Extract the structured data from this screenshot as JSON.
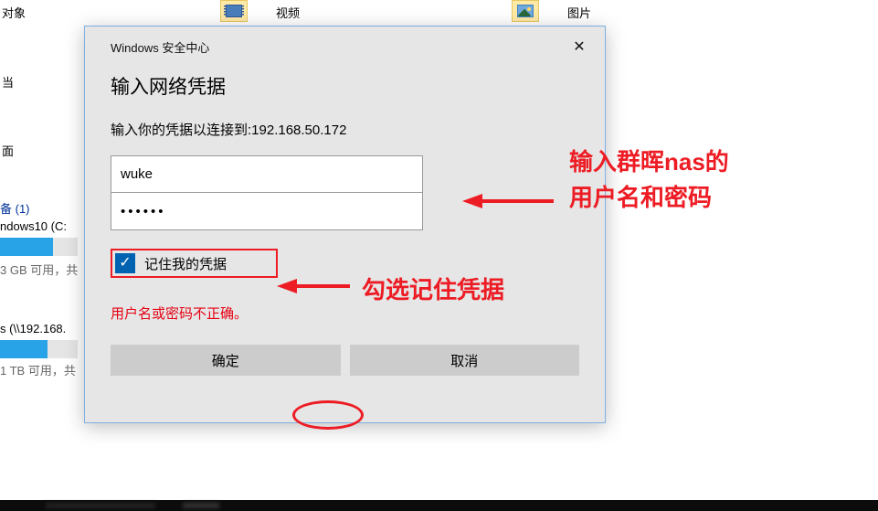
{
  "background": {
    "items": {
      "obj_label": "对象",
      "video_label": "视频",
      "pic_label": "图片",
      "devices_header": "备 (1)",
      "drive_c": "ndows10 (C:",
      "drive_c_free": "3 GB 可用，共",
      "nas_label": "s (\\\\192.168.",
      "nas_free": "1 TB 可用，共",
      "frag1": "当",
      "frag2": "面"
    }
  },
  "dialog": {
    "window_title": "Windows 安全中心",
    "heading": "输入网络凭据",
    "prompt_prefix": "输入你的凭据以连接到:",
    "target_host": "192.168.50.172",
    "username_value": "wuke",
    "password_value": "••••••",
    "remember_label": "记住我的凭据",
    "error_text": "用户名或密码不正确。",
    "ok_button": "确定",
    "cancel_button": "取消"
  },
  "annotations": {
    "right_line1": "输入群晖nas的",
    "right_line2": "用户名和密码",
    "left": "勾选记住凭据"
  }
}
